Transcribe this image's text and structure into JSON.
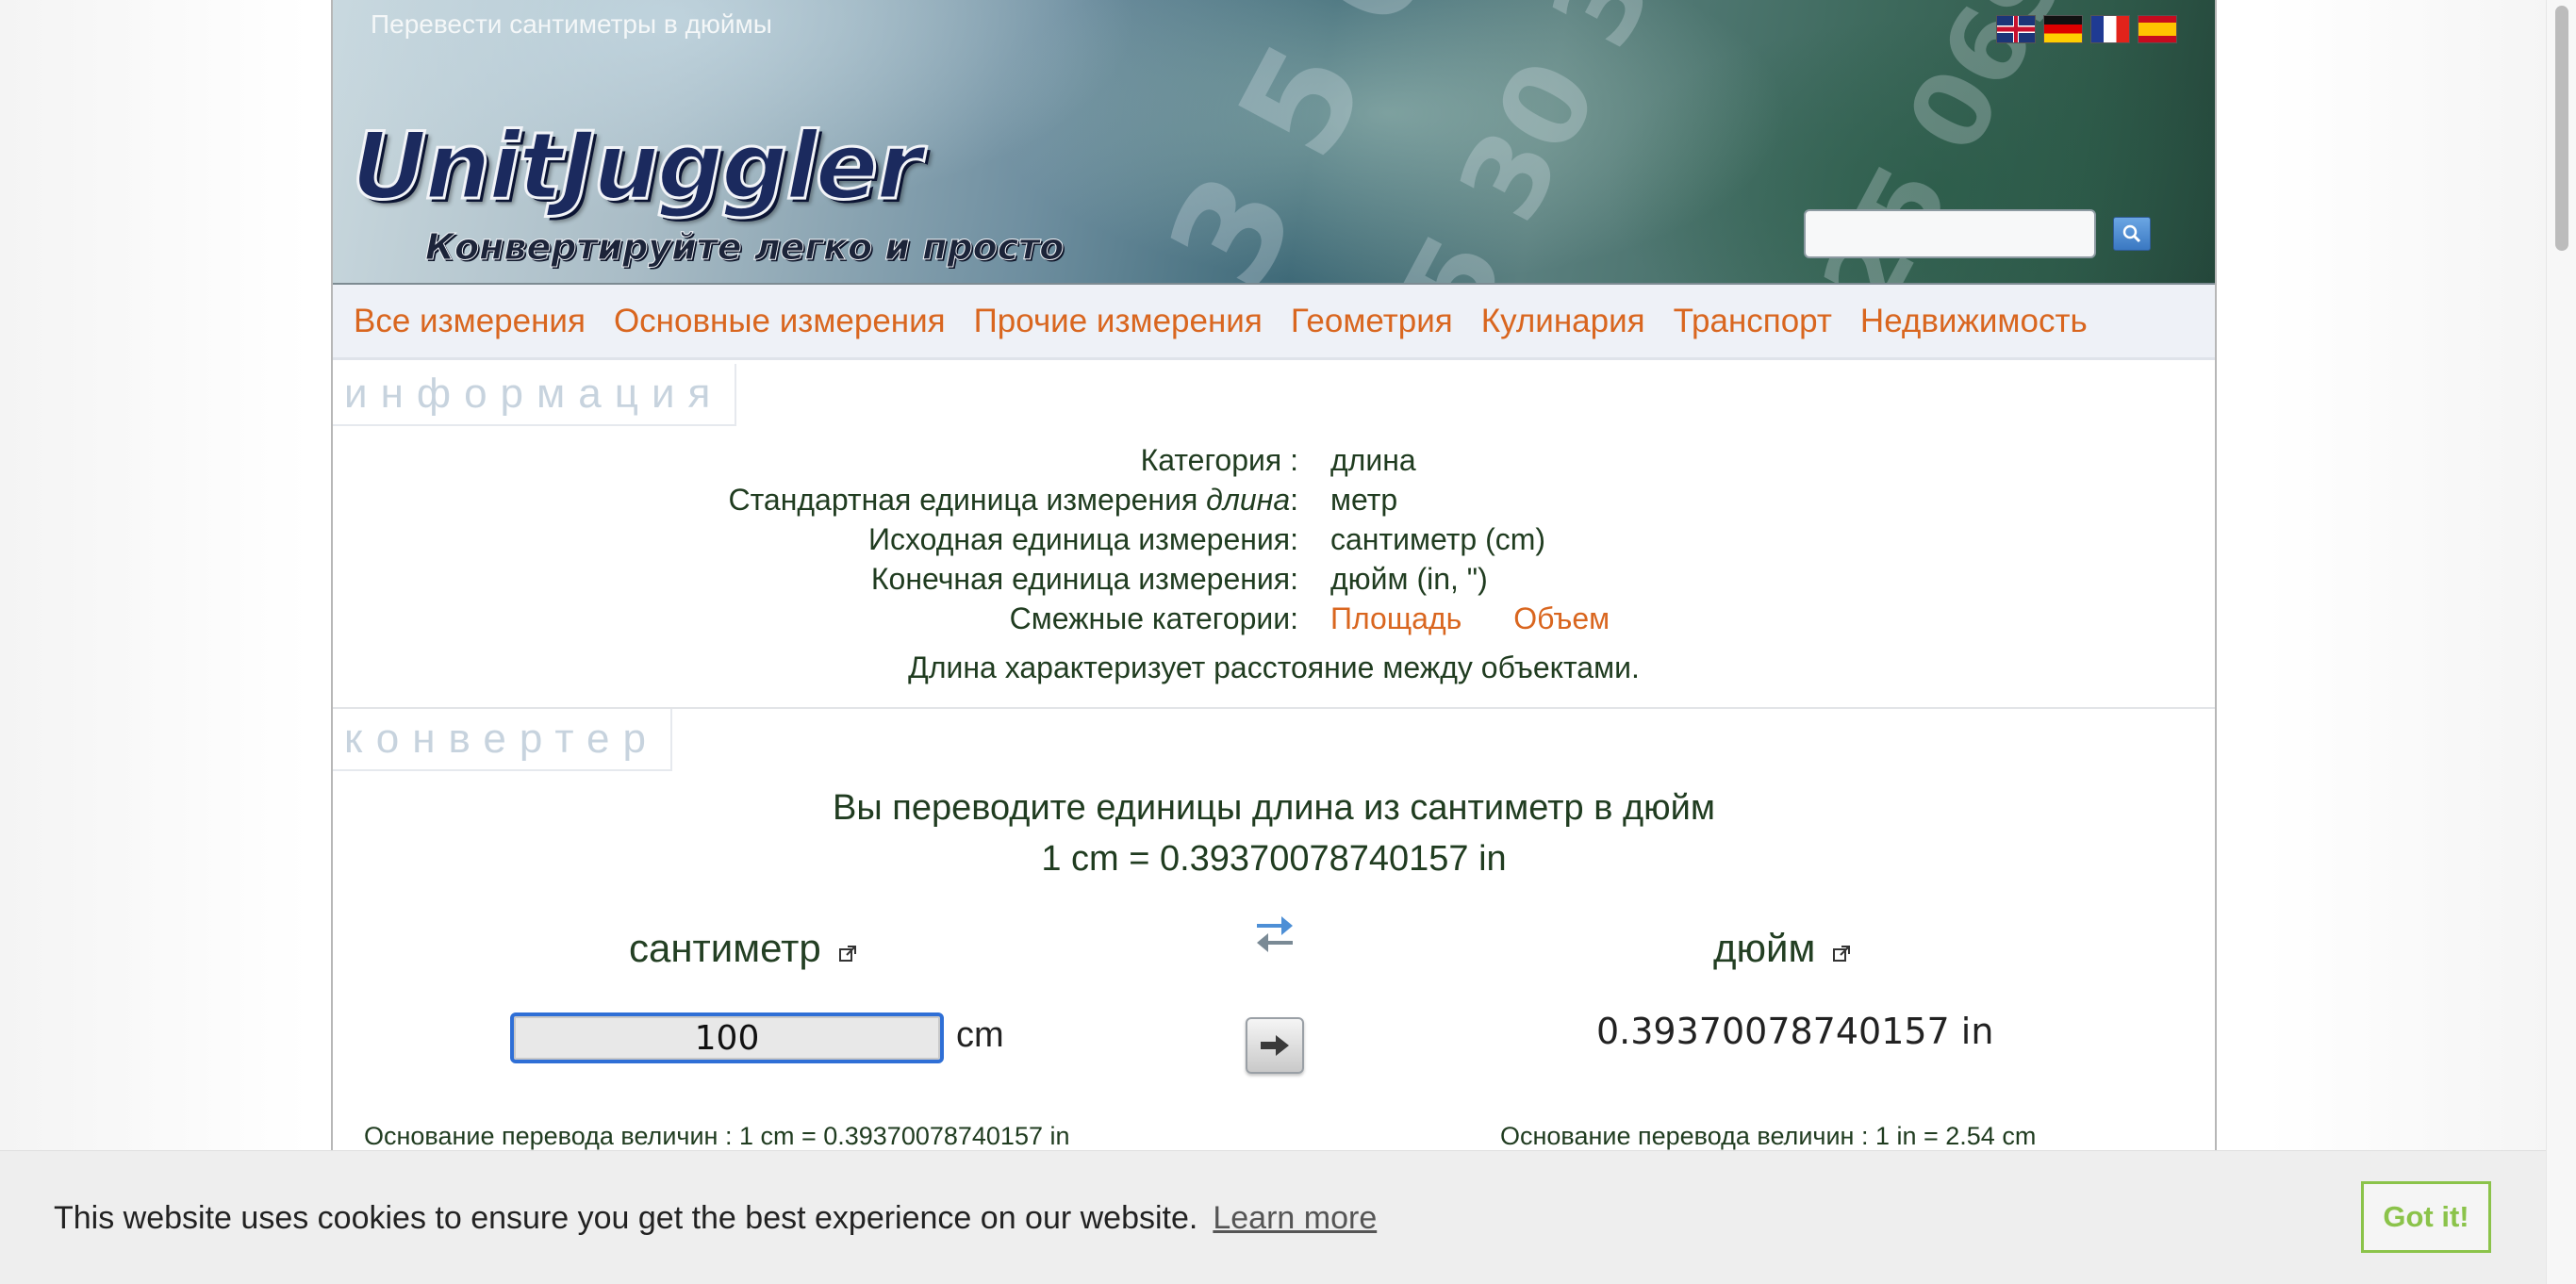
{
  "header": {
    "title": "Перевести сантиметры в дюймы",
    "logo": "UnitJuggler",
    "tagline": "Конвертируйте легко и просто",
    "languages": [
      {
        "code": "en",
        "icon": "uk-flag-icon"
      },
      {
        "code": "de",
        "icon": "germany-flag-icon"
      },
      {
        "code": "fr",
        "icon": "france-flag-icon"
      },
      {
        "code": "es",
        "icon": "spain-flag-icon"
      }
    ],
    "search": {
      "value": "",
      "placeholder": "",
      "icon": "search-icon"
    }
  },
  "nav": {
    "items": [
      {
        "label": "Все измерения"
      },
      {
        "label": "Основные измерения"
      },
      {
        "label": "Прочие измерения"
      },
      {
        "label": "Геометрия"
      },
      {
        "label": "Кулинария"
      },
      {
        "label": "Транспорт"
      },
      {
        "label": "Недвижимость"
      }
    ]
  },
  "info": {
    "section_label": "информация",
    "rows": [
      {
        "key": "Категория :",
        "value": "длина"
      },
      {
        "key_prefix": "Стандартная единица измерения",
        "key_italic": "длина",
        "key_suffix": ":",
        "value": "метр"
      },
      {
        "key": "Исходная единица измерения:",
        "value": "сантиметр (cm)"
      },
      {
        "key": "Конечная единица измерения:",
        "value": "дюйм (in, \")"
      }
    ],
    "related": {
      "key": "Смежные категории:",
      "links": [
        "Площадь",
        "Объем"
      ]
    },
    "description": "Длина характеризует расстояние между объектами."
  },
  "converter": {
    "section_label": "конвертер",
    "heading": "Вы переводите единицы длина из сантиметр в дюйм",
    "formula": "1 cm = 0.39370078740157 in",
    "from_unit": "сантиметр",
    "to_unit": "дюйм",
    "input_value": "100",
    "input_suffix": "cm",
    "result": "0.39370078740157 in",
    "from_basis": "Основание перевода величин : 1 cm = 0.39370078740157 in",
    "to_basis": "Основание перевода величин : 1 in = 2.54 cm",
    "swap_icon": "swap-arrows-icon",
    "convert_icon": "arrow-right-icon",
    "external_icon": "external-link-icon"
  },
  "cookie": {
    "message": "This website uses cookies to ensure you get the best experience on our website.",
    "learn_more": "Learn more",
    "button": "Got it!"
  },
  "colors": {
    "link": "#d9661f",
    "text": "#203c20",
    "focus": "#2f6fd6",
    "cookie_accent": "#8bc34a"
  }
}
